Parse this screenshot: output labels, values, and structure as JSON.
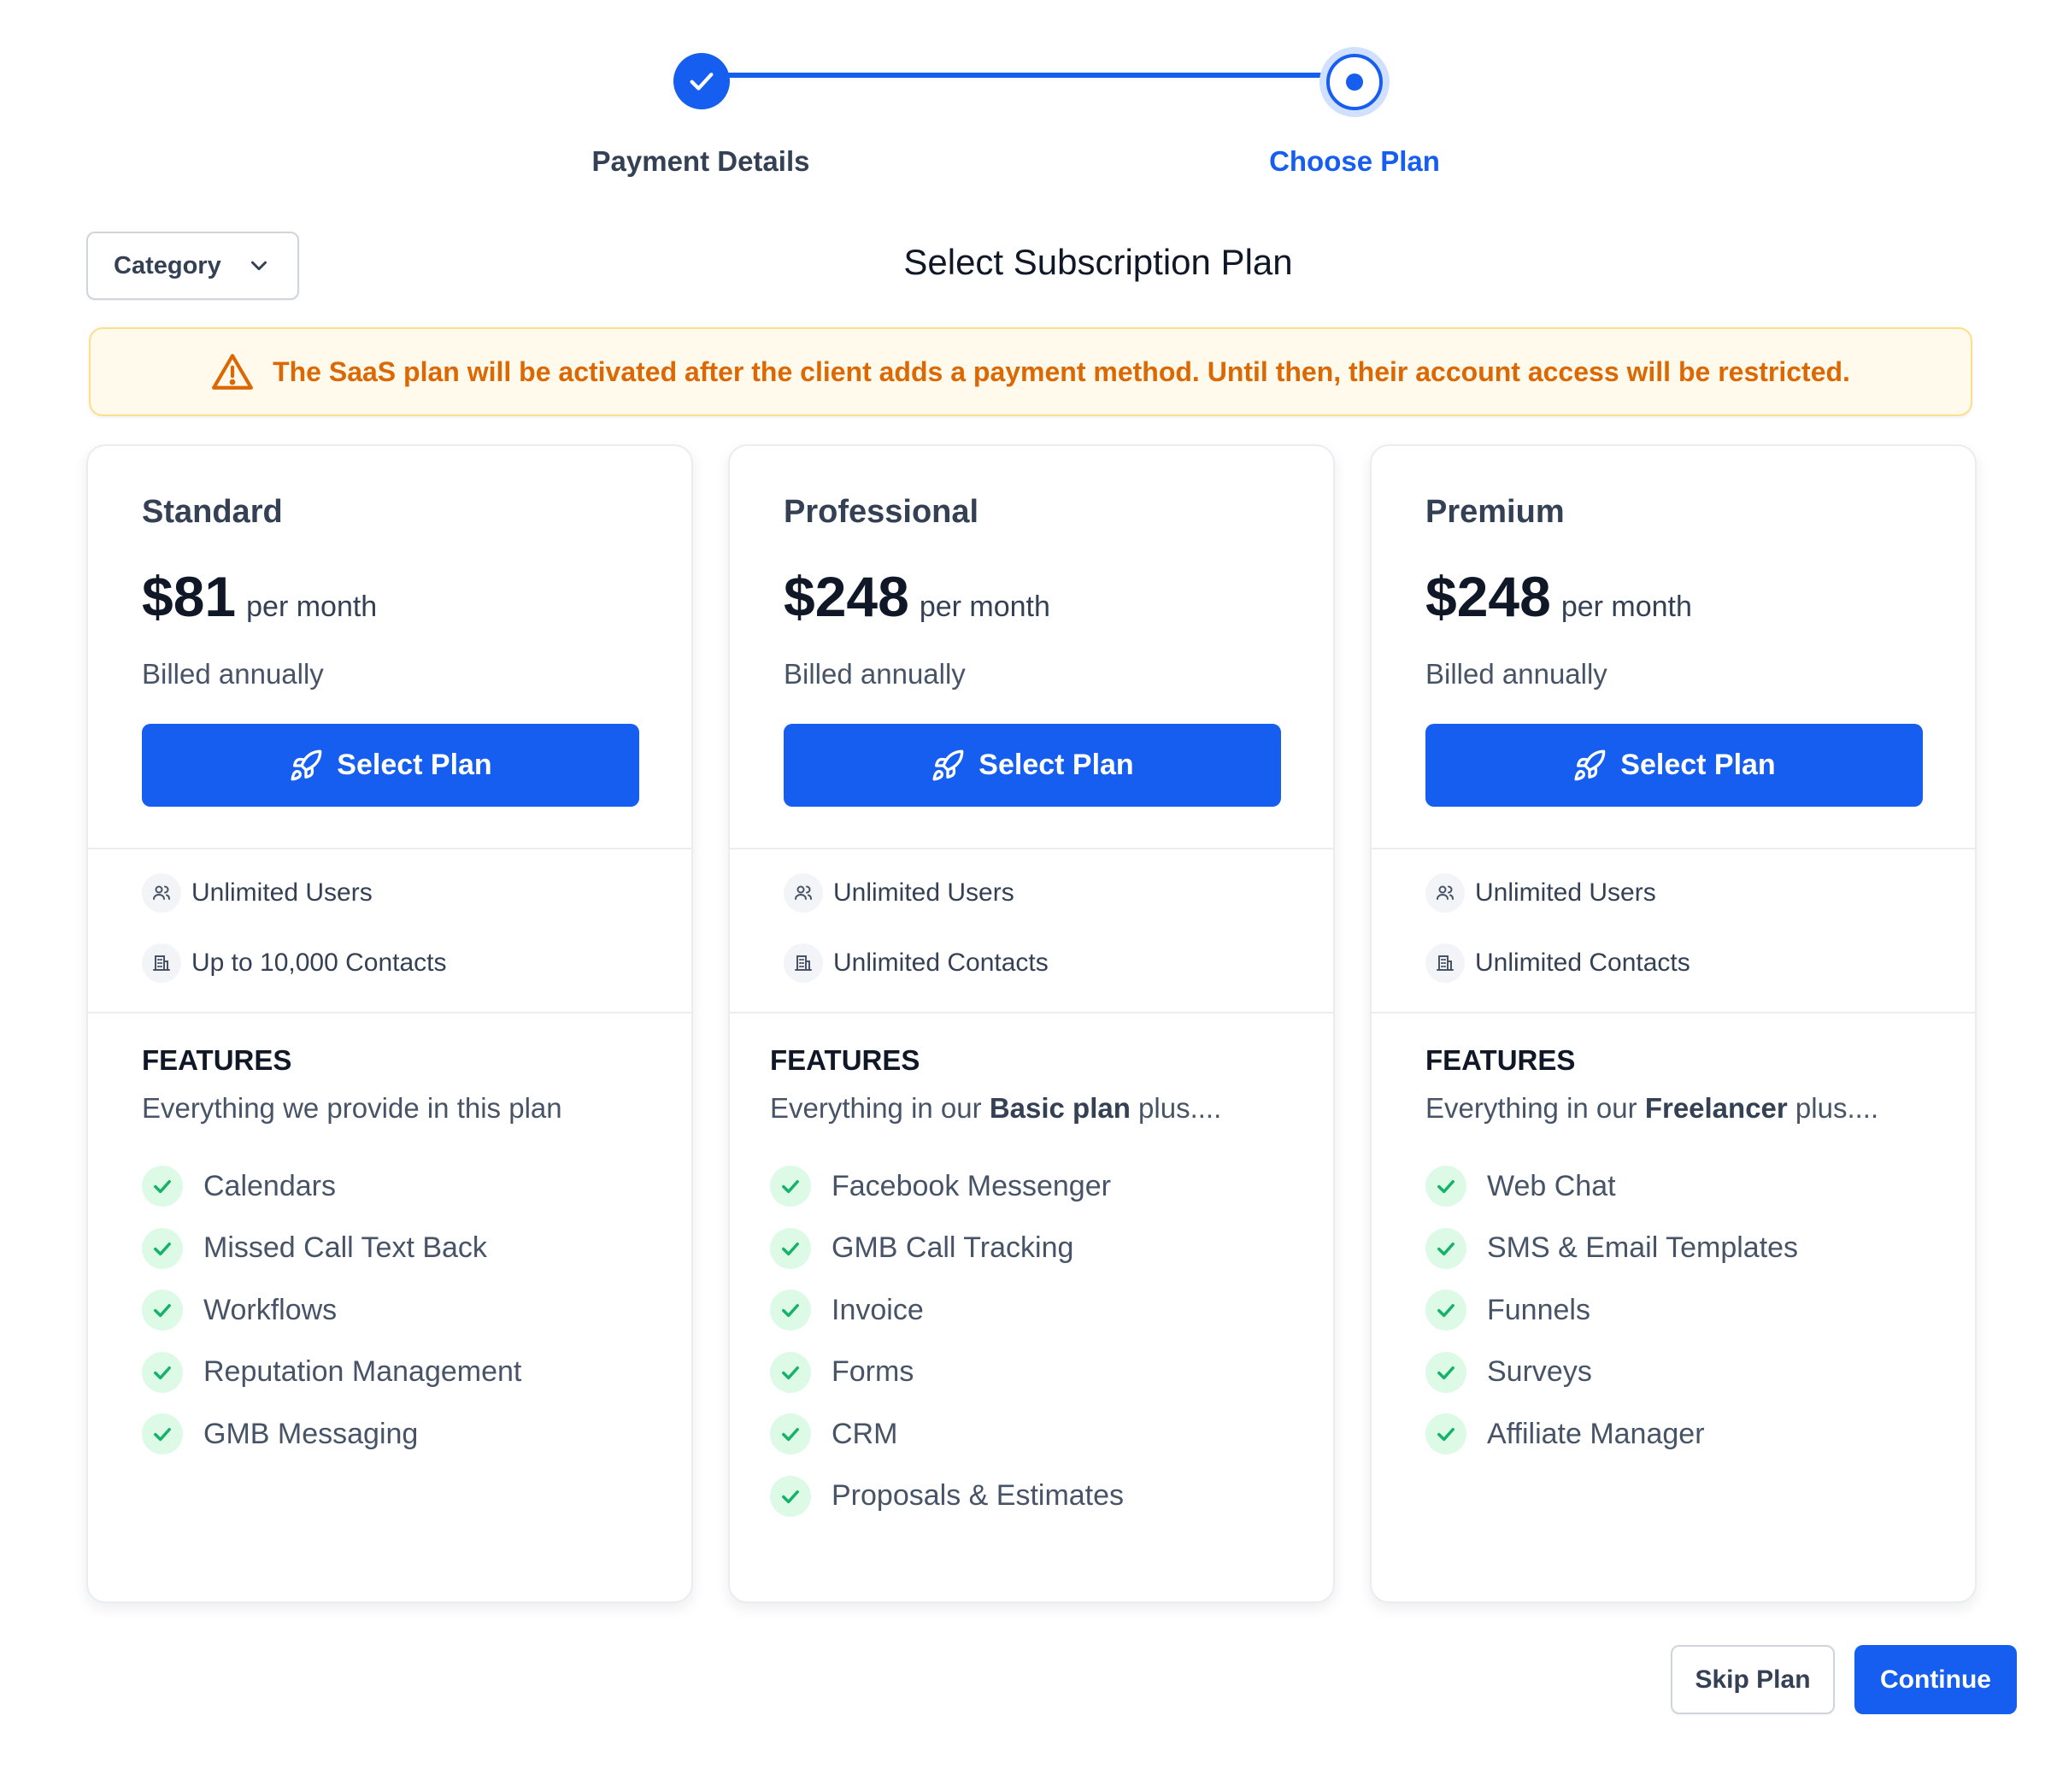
{
  "stepper": {
    "steps": [
      {
        "label": "Payment Details",
        "state": "completed"
      },
      {
        "label": "Choose Plan",
        "state": "current"
      }
    ]
  },
  "header": {
    "category_label": "Category",
    "title": "Select Subscription Plan"
  },
  "alert": {
    "icon": "warning-triangle-icon",
    "text": "The SaaS plan will be activated after the client adds a payment method. Until then, their account access will be restricted."
  },
  "plans": [
    {
      "name": "Standard",
      "price": "$81",
      "period": "per month",
      "billing": "Billed annually",
      "button_label": "Select Plan",
      "quotas": [
        "Unlimited Users",
        "Up to 10,000 Contacts"
      ],
      "features_heading": "FEATURES",
      "features_intro_pre": "Everything we provide in this plan",
      "features_intro_bold": "",
      "features_intro_post": "",
      "features": [
        "Calendars",
        "Missed Call Text Back",
        "Workflows",
        "Reputation Management",
        "GMB Messaging"
      ]
    },
    {
      "name": "Professional",
      "price": "$248",
      "period": "per month",
      "billing": "Billed annually",
      "button_label": "Select Plan",
      "quotas": [
        "Unlimited Users",
        "Unlimited Contacts"
      ],
      "features_heading": "FEATURES",
      "features_intro_pre": "Everything in our ",
      "features_intro_bold": "Basic plan",
      "features_intro_post": " plus....",
      "features": [
        "Facebook Messenger",
        "GMB Call Tracking",
        "Invoice",
        "Forms",
        "CRM",
        "Proposals & Estimates"
      ]
    },
    {
      "name": "Premium",
      "price": "$248",
      "period": "per month",
      "billing": "Billed annually",
      "button_label": "Select Plan",
      "quotas": [
        "Unlimited Users",
        "Unlimited Contacts"
      ],
      "features_heading": "FEATURES",
      "features_intro_pre": "Everything in our ",
      "features_intro_bold": "Freelancer",
      "features_intro_post": " plus....",
      "features": [
        "Web Chat",
        "SMS & Email Templates",
        "Funnels",
        "Surveys",
        "Affiliate Manager"
      ]
    }
  ],
  "footer": {
    "skip_label": "Skip Plan",
    "continue_label": "Continue"
  },
  "colors": {
    "primary": "#155eef",
    "warning_text": "#dc6803",
    "warning_bg": "#fffaeb",
    "success": "#17b26a"
  }
}
